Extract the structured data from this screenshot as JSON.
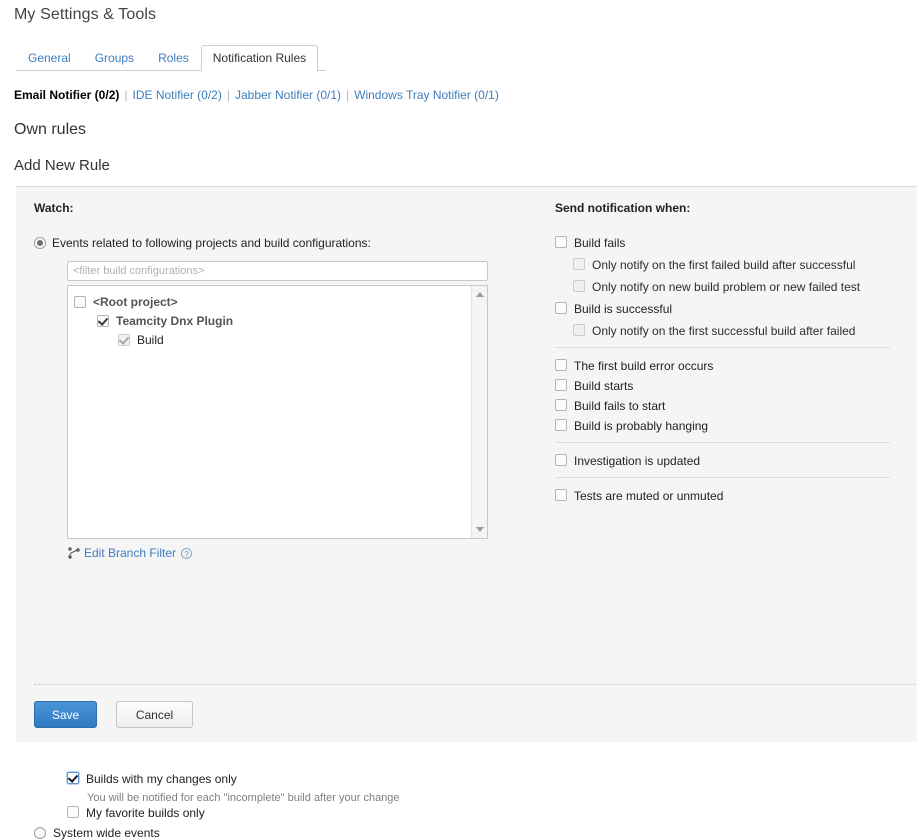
{
  "page": {
    "title": "My Settings & Tools"
  },
  "tabs": [
    {
      "label": "General",
      "active": false
    },
    {
      "label": "Groups",
      "active": false
    },
    {
      "label": "Roles",
      "active": false
    },
    {
      "label": "Notification Rules",
      "active": true
    }
  ],
  "notifiers": [
    {
      "label": "Email Notifier (0/2)",
      "current": true
    },
    {
      "label": "IDE Notifier (0/2)",
      "current": false
    },
    {
      "label": "Jabber Notifier (0/1)",
      "current": false
    },
    {
      "label": "Windows Tray Notifier (0/1)",
      "current": false
    }
  ],
  "notifier_separator": "|",
  "headings": {
    "own_rules": "Own rules",
    "add_new_rule": "Add New Rule"
  },
  "watch": {
    "heading": "Watch:",
    "option_events": "Events related to following projects and build configurations:",
    "option_events_selected": true,
    "option_system_wide": "System wide events",
    "option_system_wide_selected": false,
    "filter_placeholder": "<filter build configurations>",
    "filter_value": "",
    "tree": [
      {
        "label": "<Root project>",
        "level": 0,
        "checked": false,
        "disabled": false,
        "style": "root"
      },
      {
        "label": "Teamcity Dnx Plugin",
        "level": 1,
        "checked": true,
        "disabled": false,
        "style": "project"
      },
      {
        "label": "Build",
        "level": 2,
        "checked": true,
        "disabled": true,
        "style": "build"
      }
    ],
    "branch_filter_link": "Edit Branch Filter",
    "branch_filter_help": "?",
    "builds_with_my_changes": {
      "label": "Builds with my changes only",
      "checked": true,
      "hint": "You will be notified for each \"incomplete\" build after your change"
    },
    "my_favorite_builds": {
      "label": "My favorite builds only",
      "checked": false
    }
  },
  "send_notification": {
    "heading": "Send notification when:",
    "groups": [
      {
        "items": [
          {
            "label": "Build fails",
            "checked": false,
            "sub": false
          },
          {
            "label": "Only notify on the first failed build after successful",
            "checked": false,
            "sub": true
          },
          {
            "label": "Only notify on new build problem or new failed test",
            "checked": false,
            "sub": true
          },
          {
            "label": "Build is successful",
            "checked": false,
            "sub": false
          },
          {
            "label": "Only notify on the first successful build after failed",
            "checked": false,
            "sub": true
          }
        ]
      },
      {
        "items": [
          {
            "label": "The first build error occurs",
            "checked": false,
            "sub": false
          },
          {
            "label": "Build starts",
            "checked": false,
            "sub": false
          },
          {
            "label": "Build fails to start",
            "checked": false,
            "sub": false
          },
          {
            "label": "Build is probably hanging",
            "checked": false,
            "sub": false
          }
        ]
      },
      {
        "items": [
          {
            "label": "Investigation is updated",
            "checked": false,
            "sub": false
          }
        ]
      },
      {
        "items": [
          {
            "label": "Tests are muted or unmuted",
            "checked": false,
            "sub": false
          }
        ]
      }
    ]
  },
  "footer": {
    "save_label": "Save",
    "cancel_label": "Cancel"
  },
  "colors": {
    "link": "#3d7dbd",
    "panel_bg": "#f5f5f5",
    "save_button": "#3a84cc"
  }
}
